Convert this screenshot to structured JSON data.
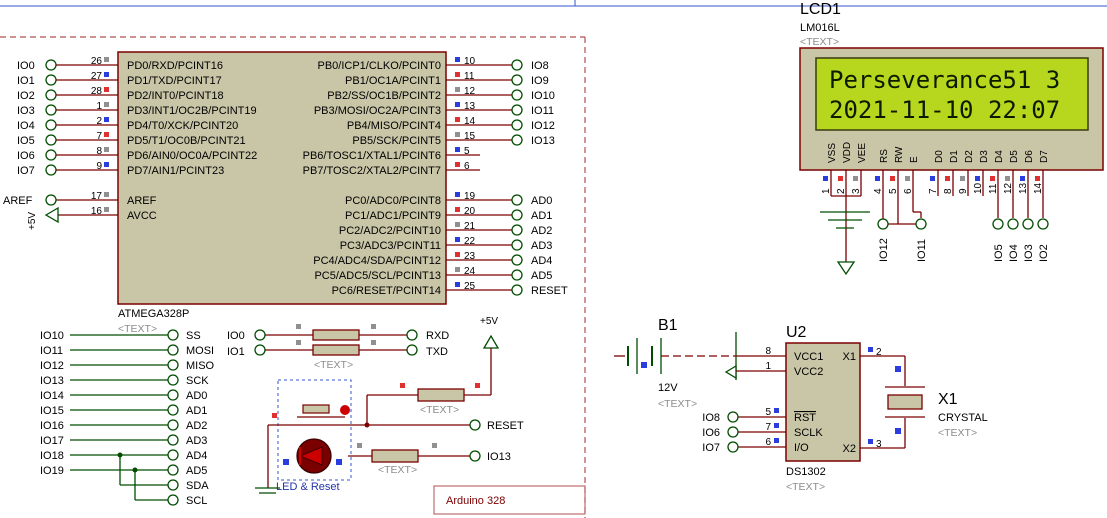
{
  "mcu": {
    "name": "ATMEGA328P",
    "text_placeholder": "<TEXT>",
    "left_pins": [
      {
        "num": "26",
        "name": "PD0/RXD/PCINT16",
        "net": "IO0"
      },
      {
        "num": "27",
        "name": "PD1/TXD/PCINT17",
        "net": "IO1"
      },
      {
        "num": "28",
        "name": "PD2/INT0/PCINT18",
        "net": "IO2"
      },
      {
        "num": "1",
        "name": "PD3/INT1/OC2B/PCINT19",
        "net": "IO3"
      },
      {
        "num": "2",
        "name": "PD4/T0/XCK/PCINT20",
        "net": "IO4"
      },
      {
        "num": "7",
        "name": "PD5/T1/OC0B/PCINT21",
        "net": "IO5"
      },
      {
        "num": "8",
        "name": "PD6/AIN0/OC0A/PCINT22",
        "net": "IO6"
      },
      {
        "num": "9",
        "name": "PD7/AIN1/PCINT23",
        "net": "IO7"
      }
    ],
    "aref": {
      "num": "17",
      "name": "AREF",
      "net": "AREF"
    },
    "avcc": {
      "num": "16",
      "name": "AVCC",
      "net": "+5V"
    },
    "right_pins_b": [
      {
        "num": "10",
        "name": "PB0/ICP1/CLKO/PCINT0",
        "net": "IO8"
      },
      {
        "num": "11",
        "name": "PB1/OC1A/PCINT1",
        "net": "IO9"
      },
      {
        "num": "12",
        "name": "PB2/SS/OC1B/PCINT2",
        "net": "IO10"
      },
      {
        "num": "13",
        "name": "PB3/MOSI/OC2A/PCINT3",
        "net": "IO11"
      },
      {
        "num": "14",
        "name": "PB4/MISO/PCINT4",
        "net": "IO12"
      },
      {
        "num": "15",
        "name": "PB5/SCK/PCINT5",
        "net": "IO13"
      },
      {
        "num": "5",
        "name": "PB6/TOSC1/XTAL1/PCINT6",
        "net": ""
      },
      {
        "num": "6",
        "name": "PB7/TOSC2/XTAL2/PCINT7",
        "net": ""
      }
    ],
    "right_pins_c": [
      {
        "num": "19",
        "name": "PC0/ADC0/PCINT8",
        "net": "AD0"
      },
      {
        "num": "20",
        "name": "PC1/ADC1/PCINT9",
        "net": "AD1"
      },
      {
        "num": "21",
        "name": "PC2/ADC2/PCINT10",
        "net": "AD2"
      },
      {
        "num": "22",
        "name": "PC3/ADC3/PCINT11",
        "net": "AD3"
      },
      {
        "num": "23",
        "name": "PC4/ADC4/SDA/PCINT12",
        "net": "AD4"
      },
      {
        "num": "24",
        "name": "PC5/ADC5/SCL/PCINT13",
        "net": "AD5"
      },
      {
        "num": "25",
        "name": "PC6/RESET/PCINT14",
        "net": "RESET"
      }
    ]
  },
  "alias_rows": [
    {
      "left": "IO10",
      "right": "SS"
    },
    {
      "left": "IO11",
      "right": "MOSI"
    },
    {
      "left": "IO12",
      "right": "MISO"
    },
    {
      "left": "IO13",
      "right": "SCK"
    },
    {
      "left": "IO14",
      "right": "AD0"
    },
    {
      "left": "IO15",
      "right": "AD1"
    },
    {
      "left": "IO16",
      "right": "AD2"
    },
    {
      "left": "IO17",
      "right": "AD3"
    },
    {
      "left": "IO18",
      "right": "AD4"
    },
    {
      "left": "IO19",
      "right": "AD5"
    },
    {
      "left": "",
      "right": "SDA"
    },
    {
      "left": "",
      "right": "SCL"
    }
  ],
  "serial": {
    "io0": "IO0",
    "io1": "IO1",
    "rxd": "RXD",
    "txd": "TXD",
    "text": "<TEXT>"
  },
  "power_label": "+5V",
  "reset_block": {
    "reset": "RESET",
    "io13": "IO13",
    "label": "LED & Reset",
    "text1": "<TEXT>",
    "text2": "<TEXT>"
  },
  "frame_title": "Arduino 328",
  "lcd": {
    "ref": "LCD1",
    "part": "LM016L",
    "text": "<TEXT>",
    "line1": "Perseverance51 3",
    "line2": "2021-11-10 22:07",
    "pin_names": [
      "VSS",
      "VDD",
      "VEE",
      "RS",
      "RW",
      "E",
      "D0",
      "D1",
      "D2",
      "D3",
      "D4",
      "D5",
      "D6",
      "D7"
    ],
    "pin_nums": [
      "1",
      "2",
      "3",
      "4",
      "5",
      "6",
      "7",
      "8",
      "9",
      "10",
      "11",
      "12",
      "13",
      "14"
    ],
    "bottom_nets": [
      "IO12",
      "IO11",
      "IO5",
      "IO4",
      "IO3",
      "IO2"
    ]
  },
  "battery": {
    "ref": "B1",
    "value": "12V",
    "text": "<TEXT>"
  },
  "rtc": {
    "ref": "U2",
    "part": "DS1302",
    "text": "<TEXT>",
    "pins_left": [
      {
        "num": "8",
        "name": "VCC1"
      },
      {
        "num": "1",
        "name": "VCC2"
      },
      {
        "num": "5",
        "name": "RST",
        "net": "IO8"
      },
      {
        "num": "7",
        "name": "SCLK",
        "net": "IO6"
      },
      {
        "num": "6",
        "name": "I/O",
        "net": "IO7"
      }
    ],
    "pins_right": [
      {
        "num": "2",
        "name": "X1"
      },
      {
        "num": "3",
        "name": "X2"
      }
    ]
  },
  "crystal": {
    "ref": "X1",
    "part": "CRYSTAL",
    "text": "<TEXT>"
  },
  "colors": {
    "chip_fill": "#c9c6a8",
    "wire": "#7a0000",
    "net_wire": "#004d00",
    "lcd_screen": "#b7d71e",
    "frame": "#b05050",
    "pin_red": "#e03030",
    "pin_blue": "#2a3ee0",
    "pin_gray": "#909090"
  }
}
